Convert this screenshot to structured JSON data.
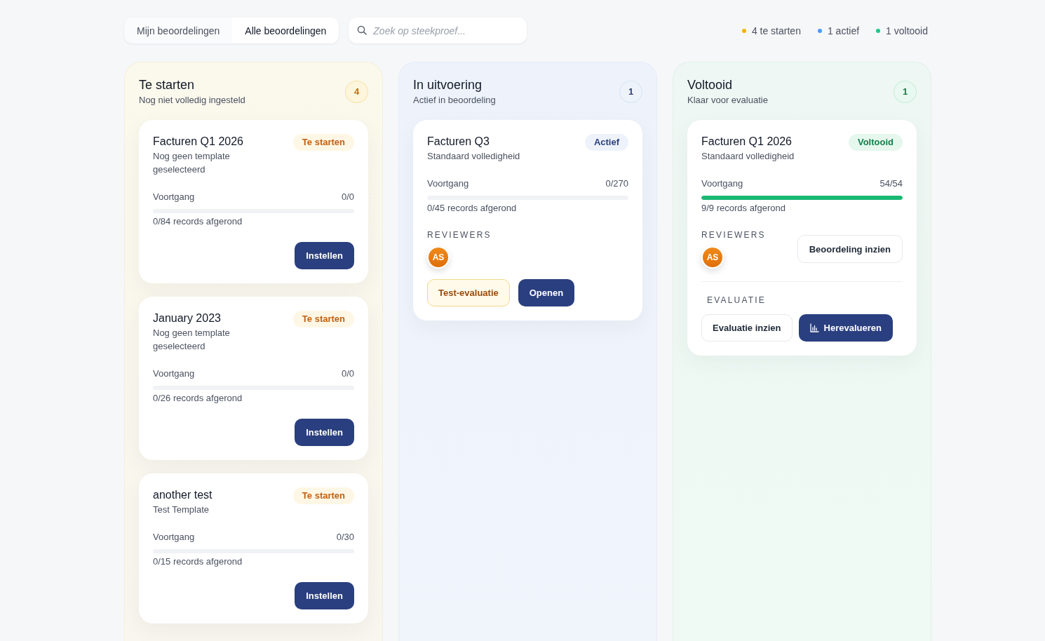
{
  "view_tabs": [
    {
      "label": "Mijn beoordelingen",
      "selected": false
    },
    {
      "label": "Alle beoordelingen",
      "selected": true
    }
  ],
  "search": {
    "placeholder": "Zoek op steekproef..."
  },
  "legend": [
    {
      "label": "4 te starten",
      "color": "#f5b301"
    },
    {
      "label": "1 actief",
      "color": "#4b9bf5"
    },
    {
      "label": "1 voltooid",
      "color": "#1ec98b"
    }
  ],
  "columns": [
    {
      "kind": "start",
      "title": "Te starten",
      "subtitle": "Nog niet volledig ingesteld",
      "count": "4",
      "cards": [
        {
          "title": "Facturen Q1 2026",
          "badge": "Te starten",
          "subtitle": "Nog geen template geselecteerd",
          "progress_label": "Voortgang",
          "progress_value": "0/0",
          "level": 0,
          "records": "0/84 records afgerond",
          "actions": [
            {
              "label": "Instellen",
              "kind": "primary"
            }
          ]
        },
        {
          "title": "January 2023",
          "badge": "Te starten",
          "subtitle": "Nog geen template geselecteerd",
          "progress_label": "Voortgang",
          "progress_value": "0/0",
          "level": 0,
          "records": "0/26 records afgerond",
          "actions": [
            {
              "label": "Instellen",
              "kind": "primary"
            }
          ]
        },
        {
          "title": "another test",
          "badge": "Te starten",
          "subtitle": "Test Template",
          "progress_label": "Voortgang",
          "progress_value": "0/30",
          "level": 0,
          "records": "0/15 records afgerond",
          "actions": [
            {
              "label": "Instellen",
              "kind": "primary"
            }
          ]
        }
      ]
    },
    {
      "kind": "active",
      "title": "In uitvoering",
      "subtitle": "Actief in beoordeling",
      "count": "1",
      "cards": [
        {
          "title": "Facturen Q3",
          "badge": "Actief",
          "subtitle": "Standaard volledigheid",
          "progress_label": "Voortgang",
          "progress_value": "0/270",
          "level": 0,
          "records": "0/45 records afgerond",
          "reviewers": {
            "label": "REVIEWERS",
            "people": [
              {
                "initials": "AS"
              }
            ]
          },
          "actions": [
            {
              "label": "Test-evaluatie",
              "kind": "warning"
            },
            {
              "label": "Openen",
              "kind": "primary"
            }
          ]
        }
      ]
    },
    {
      "kind": "done",
      "title": "Voltooid",
      "subtitle": "Klaar voor evaluatie",
      "count": "1",
      "cards": [
        {
          "title": "Facturen Q1 2026",
          "badge": "Voltooid",
          "subtitle": "Standaard volledigheid",
          "progress_label": "Voortgang",
          "progress_value": "54/54",
          "level": 1,
          "records": "9/9 records afgerond",
          "reviewers": {
            "label": "REVIEWERS",
            "people": [
              {
                "initials": "AS"
              }
            ]
          },
          "side_action": {
            "label": "Beoordeling inzien",
            "kind": "secondary"
          },
          "evaluation": {
            "label": "EVALUATIE",
            "actions": [
              {
                "label": "Evaluatie inzien",
                "kind": "secondary"
              },
              {
                "label": "Herevalueren",
                "kind": "primary",
                "icon": true
              }
            ]
          }
        }
      ]
    }
  ]
}
